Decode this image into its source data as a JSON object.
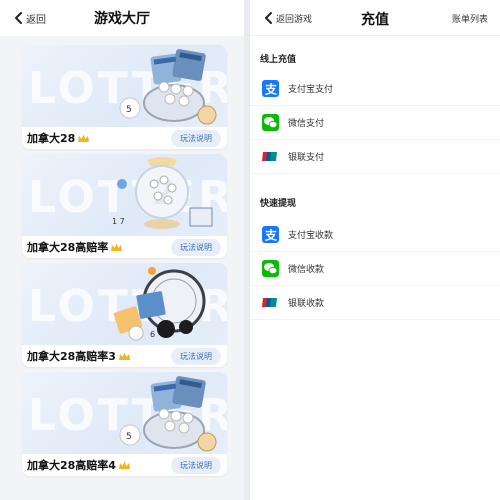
{
  "hall": {
    "back_label": "返回",
    "title": "游戏大厅",
    "watermark": "LOTTERY",
    "games": [
      {
        "name": "加拿大28",
        "rules_label": "玩法说明"
      },
      {
        "name": "加拿大28高赔率",
        "rules_label": "玩法说明"
      },
      {
        "name": "加拿大28高赔率3",
        "rules_label": "玩法说明"
      },
      {
        "name": "加拿大28高赔率4",
        "rules_label": "玩法说明"
      }
    ]
  },
  "recharge": {
    "back_label": "返回游戏",
    "title": "充值",
    "account_list_label": "账单列表",
    "online_section": {
      "title": "线上充值",
      "items": [
        {
          "label": "支付宝支付",
          "icon": "alipay-icon"
        },
        {
          "label": "微信支付",
          "icon": "wechat-icon"
        },
        {
          "label": "银联支付",
          "icon": "unionpay-icon"
        }
      ]
    },
    "withdraw_section": {
      "title": "快速提现",
      "items": [
        {
          "label": "支付宝收款",
          "icon": "alipay-icon"
        },
        {
          "label": "微信收款",
          "icon": "wechat-icon"
        },
        {
          "label": "银联收款",
          "icon": "unionpay-icon"
        }
      ]
    }
  },
  "colors": {
    "alipay": "#1677ff",
    "wechat": "#09bb07",
    "unionpay_red": "#d9232e",
    "unionpay_blue": "#005b9f",
    "unionpay_green": "#00908c",
    "rules_text": "#3b6fb6",
    "crown": "#f2b51c"
  }
}
